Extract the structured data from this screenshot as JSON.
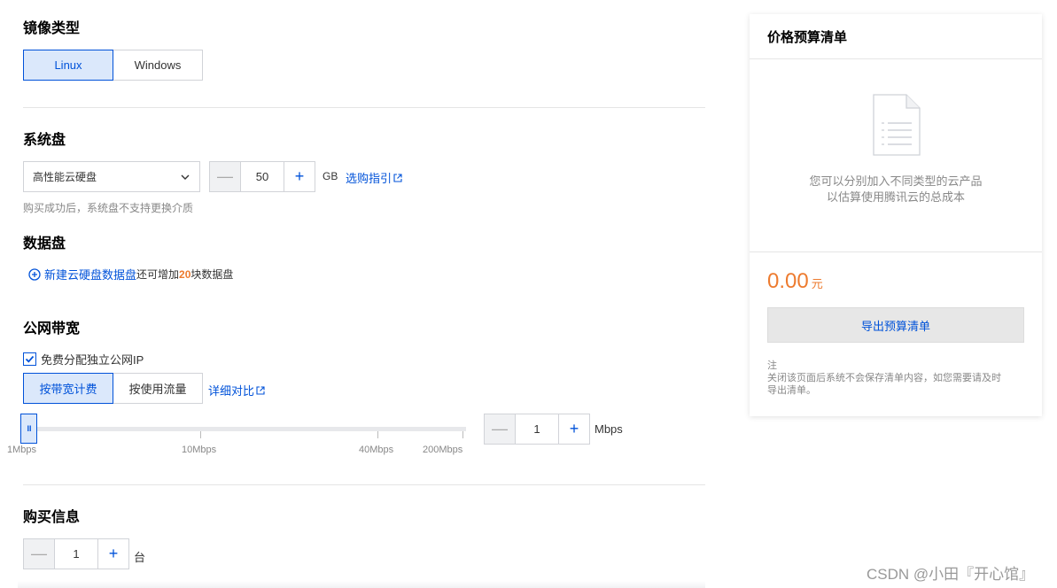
{
  "image_type": {
    "title": "镜像类型",
    "options": [
      "Linux",
      "Windows"
    ],
    "selected": "Linux"
  },
  "system_disk": {
    "title": "系统盘",
    "type_value": "高性能云硬盘",
    "size": "50",
    "unit": "GB",
    "guide_link": "选购指引",
    "hint": "购买成功后，系统盘不支持更换介质",
    "minus": "—",
    "plus": "+"
  },
  "data_disk": {
    "title": "数据盘",
    "add_link": "新建云硬盘数据盘",
    "remain_prefix": "还可增加",
    "remain_count": "20",
    "remain_suffix": "块数据盘"
  },
  "bandwidth": {
    "title": "公网带宽",
    "free_ip_label": "免费分配独立公网IP",
    "free_ip_checked": true,
    "billing_options": [
      "按带宽计费",
      "按使用流量"
    ],
    "billing_selected": "按带宽计费",
    "compare_link": "详细对比",
    "slider_labels": [
      "1Mbps",
      "10Mbps",
      "40Mbps",
      "200Mbps"
    ],
    "slider_handle": "III",
    "value": "1",
    "unit": "Mbps"
  },
  "purchase": {
    "title": "购买信息",
    "quantity": "1",
    "unit": "台"
  },
  "budget": {
    "title": "价格预算清单",
    "empty_line1": "您可以分别加入不同类型的云产品",
    "empty_line2": "以估算使用腾讯云的总成本",
    "price": "0.00",
    "currency": "元",
    "export_button": "导出预算清单",
    "note_title": "注",
    "note_text": "关闭该页面后系统不会保存清单内容，如您需要请及时导出清单。"
  },
  "watermark": "CSDN @小田『开心馆』",
  "colors": {
    "accent": "#0052d9",
    "price": "#ed7b2f",
    "active_bg": "#dbe8fb"
  }
}
